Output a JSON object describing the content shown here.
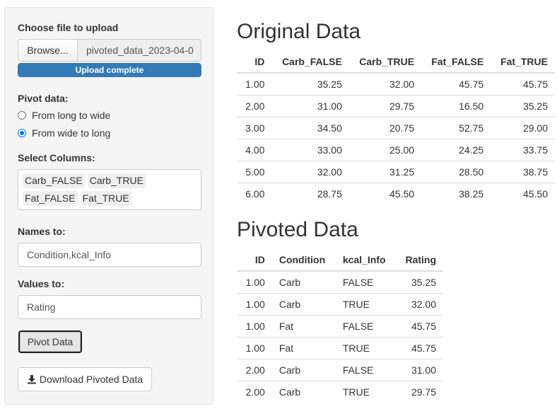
{
  "sidebar": {
    "file_label": "Choose file to upload",
    "browse_label": "Browse...",
    "file_name": "pivoted_data_2023-04-0",
    "progress_text": "Upload complete",
    "progress_percent": 100,
    "pivot_label": "Pivot data:",
    "radio_long_to_wide": "From long to wide",
    "radio_wide_to_long": "From wide to long",
    "selected_radio": "wide_to_long",
    "select_columns_label": "Select Columns:",
    "selected_columns": [
      "Carb_FALSE",
      "Carb_TRUE",
      "Fat_FALSE",
      "Fat_TRUE"
    ],
    "names_to_label": "Names to:",
    "names_to_value": "Condition,kcal_Info",
    "values_to_label": "Values to:",
    "values_to_value": "Rating",
    "pivot_button": "Pivot Data",
    "download_button": "Download Pivoted Data",
    "download_icon": "download-icon"
  },
  "original": {
    "title": "Original Data",
    "headers": [
      "ID",
      "Carb_FALSE",
      "Carb_TRUE",
      "Fat_FALSE",
      "Fat_TRUE"
    ],
    "rows": [
      [
        "1.00",
        "35.25",
        "32.00",
        "45.75",
        "45.75"
      ],
      [
        "2.00",
        "31.00",
        "29.75",
        "16.50",
        "35.25"
      ],
      [
        "3.00",
        "34.50",
        "20.75",
        "52.75",
        "29.00"
      ],
      [
        "4.00",
        "33.00",
        "25.00",
        "24.25",
        "33.75"
      ],
      [
        "5.00",
        "32.00",
        "31.25",
        "28.50",
        "38.75"
      ],
      [
        "6.00",
        "28.75",
        "45.50",
        "38.25",
        "45.50"
      ]
    ]
  },
  "pivoted": {
    "title": "Pivoted Data",
    "headers": [
      "ID",
      "Condition",
      "kcal_Info",
      "Rating"
    ],
    "rows": [
      [
        "1.00",
        "Carb",
        "FALSE",
        "35.25"
      ],
      [
        "1.00",
        "Carb",
        "TRUE",
        "32.00"
      ],
      [
        "1.00",
        "Fat",
        "FALSE",
        "45.75"
      ],
      [
        "1.00",
        "Fat",
        "TRUE",
        "45.75"
      ],
      [
        "2.00",
        "Carb",
        "FALSE",
        "31.00"
      ],
      [
        "2.00",
        "Carb",
        "TRUE",
        "29.75"
      ]
    ]
  },
  "colors": {
    "accent": "#337ab7",
    "radio": "#0075ff"
  }
}
